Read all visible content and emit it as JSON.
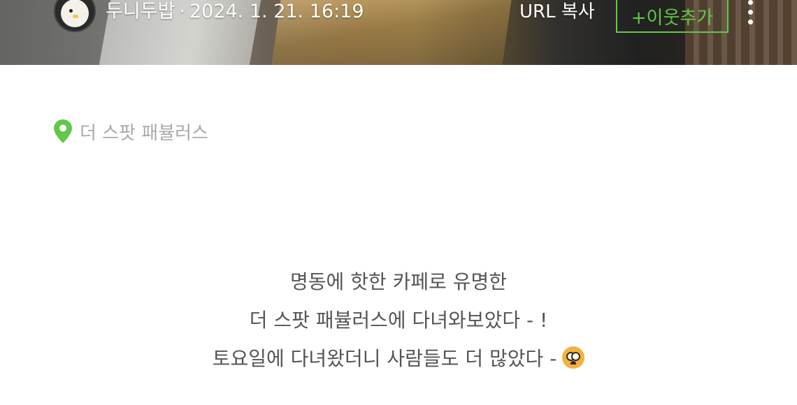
{
  "header": {
    "author_name": "두니두밥",
    "separator": "·",
    "post_datetime": "2024. 1. 21. 16:19",
    "url_copy_label": "URL 복사",
    "add_neighbor_label": "+이웃추가",
    "more_icon": "kebab-vertical-icon",
    "avatar_icon": "duck-avatar"
  },
  "location": {
    "pin_icon": "map-pin-icon",
    "pin_color": "#62c84a",
    "place_name": "더 스팟 패뷸러스"
  },
  "content": {
    "lines": [
      "명동에 핫한 카페로 유명한",
      "더 스팟 패뷸러스에 다녀와보았다 - !",
      "토요일에 다녀왔더니 사람들도 더 많았다 -"
    ],
    "emoji_icon": "flushed-face-emoji"
  },
  "colors": {
    "accent": "#62c84a",
    "body_text": "#555555",
    "muted_text": "#aaaaaa"
  }
}
